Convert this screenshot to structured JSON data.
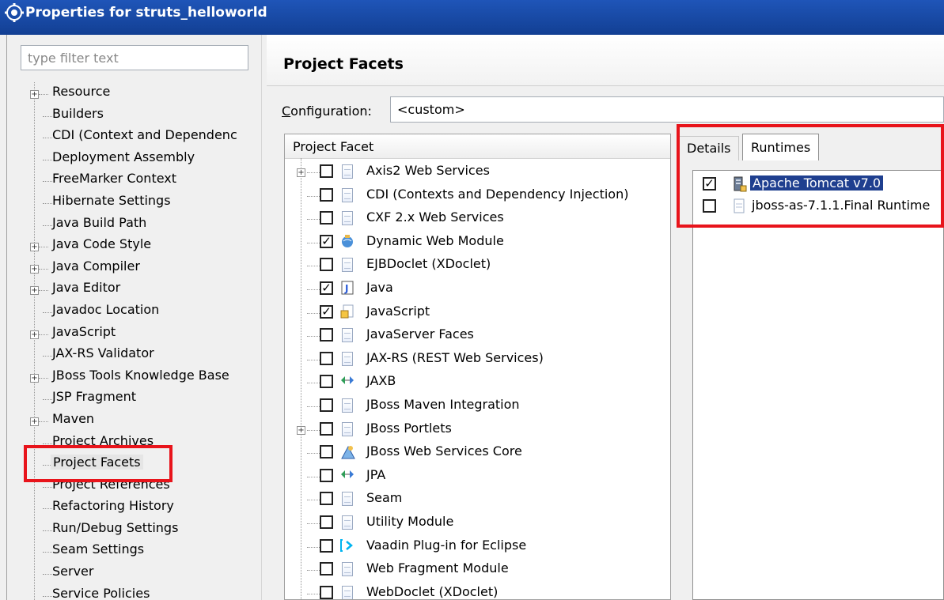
{
  "window": {
    "title": "Properties for struts_helloworld"
  },
  "filter": {
    "placeholder": "type filter text"
  },
  "nav": {
    "items": [
      {
        "label": "Resource",
        "expandable": true
      },
      {
        "label": "Builders",
        "expandable": false
      },
      {
        "label": "CDI (Context and Dependenc",
        "expandable": false
      },
      {
        "label": "Deployment Assembly",
        "expandable": false
      },
      {
        "label": "FreeMarker Context",
        "expandable": false
      },
      {
        "label": "Hibernate Settings",
        "expandable": false
      },
      {
        "label": "Java Build Path",
        "expandable": false
      },
      {
        "label": "Java Code Style",
        "expandable": true
      },
      {
        "label": "Java Compiler",
        "expandable": true
      },
      {
        "label": "Java Editor",
        "expandable": true
      },
      {
        "label": "Javadoc Location",
        "expandable": false
      },
      {
        "label": "JavaScript",
        "expandable": true
      },
      {
        "label": "JAX-RS Validator",
        "expandable": false
      },
      {
        "label": "JBoss Tools Knowledge Base",
        "expandable": true
      },
      {
        "label": "JSP Fragment",
        "expandable": false
      },
      {
        "label": "Maven",
        "expandable": true
      },
      {
        "label": "Project Archives",
        "expandable": false
      },
      {
        "label": "Project Facets",
        "expandable": false,
        "selected": true
      },
      {
        "label": "Project References",
        "expandable": false
      },
      {
        "label": "Refactoring History",
        "expandable": false
      },
      {
        "label": "Run/Debug Settings",
        "expandable": false
      },
      {
        "label": "Seam Settings",
        "expandable": false
      },
      {
        "label": "Server",
        "expandable": false
      },
      {
        "label": "Service Policies",
        "expandable": false
      }
    ]
  },
  "page": {
    "title": "Project Facets",
    "config_label_prefix": "C",
    "config_label_rest": "onfiguration:",
    "config_value": "<custom>"
  },
  "facets": {
    "header": "Project Facet",
    "rows": [
      {
        "label": "Axis2 Web Services",
        "checked": false,
        "icon": "document-icon",
        "expandable": true
      },
      {
        "label": "CDI (Contexts and Dependency Injection)",
        "checked": false,
        "icon": "document-icon"
      },
      {
        "label": "CXF 2.x Web Services",
        "checked": false,
        "icon": "document-icon"
      },
      {
        "label": "Dynamic Web Module",
        "checked": true,
        "icon": "web-module-icon"
      },
      {
        "label": "EJBDoclet (XDoclet)",
        "checked": false,
        "icon": "document-icon"
      },
      {
        "label": "Java",
        "checked": true,
        "icon": "java-icon"
      },
      {
        "label": "JavaScript",
        "checked": true,
        "icon": "javascript-icon"
      },
      {
        "label": "JavaServer Faces",
        "checked": false,
        "icon": "document-icon"
      },
      {
        "label": "JAX-RS (REST Web Services)",
        "checked": false,
        "icon": "document-icon"
      },
      {
        "label": "JAXB",
        "checked": false,
        "icon": "jaxb-icon"
      },
      {
        "label": "JBoss Maven Integration",
        "checked": false,
        "icon": "document-icon"
      },
      {
        "label": "JBoss Portlets",
        "checked": false,
        "icon": "document-icon",
        "expandable": true
      },
      {
        "label": "JBoss Web Services Core",
        "checked": false,
        "icon": "web-services-icon"
      },
      {
        "label": "JPA",
        "checked": false,
        "icon": "jpa-icon"
      },
      {
        "label": "Seam",
        "checked": false,
        "icon": "document-icon"
      },
      {
        "label": "Utility Module",
        "checked": false,
        "icon": "document-icon"
      },
      {
        "label": "Vaadin Plug-in for Eclipse",
        "checked": false,
        "icon": "vaadin-icon"
      },
      {
        "label": "Web Fragment Module",
        "checked": false,
        "icon": "document-icon"
      },
      {
        "label": "WebDoclet (XDoclet)",
        "checked": false,
        "icon": "document-icon"
      }
    ]
  },
  "tabs": {
    "details": "Details",
    "runtimes": "Runtimes",
    "active": "runtimes"
  },
  "runtimes": [
    {
      "label": "Apache Tomcat v7.0",
      "checked": true,
      "selected": true,
      "icon": "tomcat-server-icon"
    },
    {
      "label": "jboss-as-7.1.1.Final Runtime",
      "checked": false,
      "selected": false,
      "icon": "document-icon"
    }
  ],
  "colors": {
    "title_bar": "#1f55b8",
    "highlight": "#e8141b",
    "selection": "#1f3f8f"
  }
}
